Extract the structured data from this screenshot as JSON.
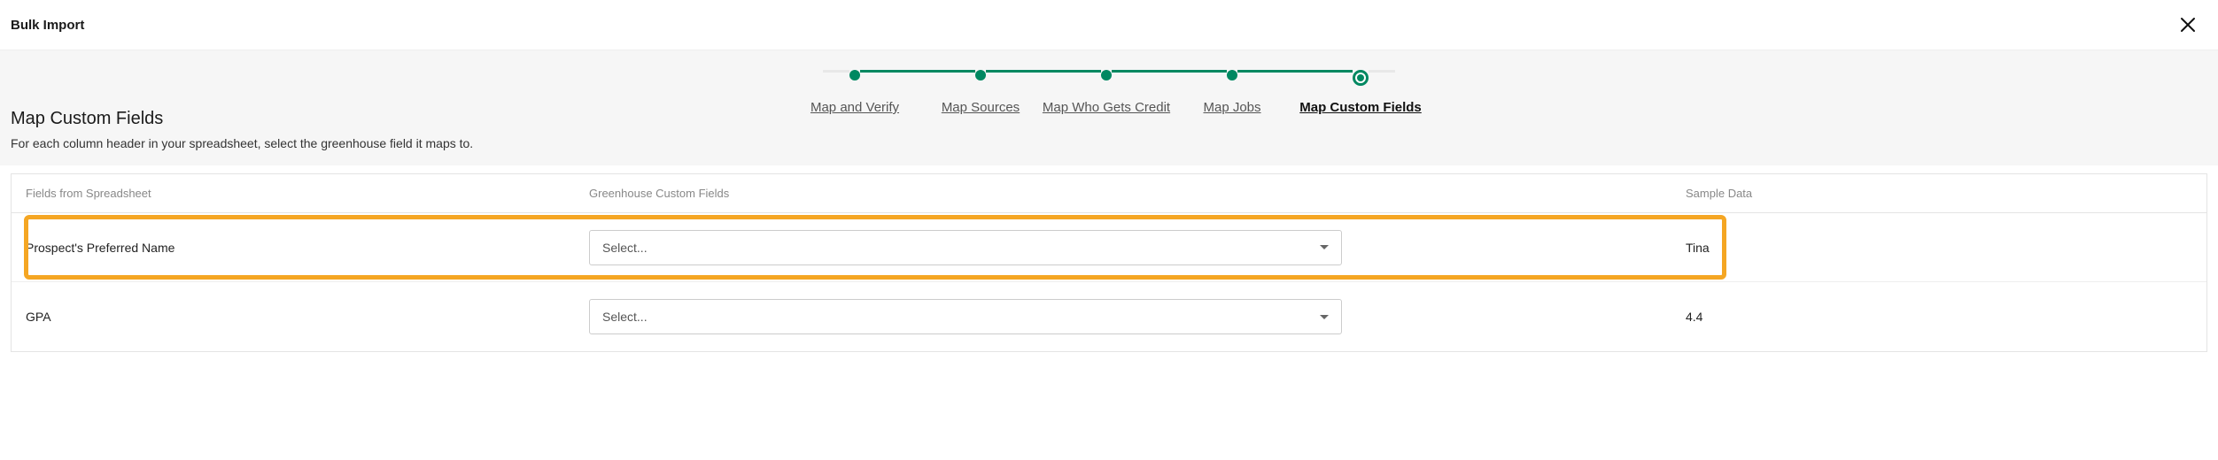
{
  "header": {
    "title": "Bulk Import"
  },
  "stepper": {
    "steps": [
      {
        "label": "Map and Verify",
        "state": "done"
      },
      {
        "label": "Map Sources",
        "state": "done"
      },
      {
        "label": "Map Who Gets Credit",
        "state": "done"
      },
      {
        "label": "Map Jobs",
        "state": "done"
      },
      {
        "label": "Map Custom Fields",
        "state": "current"
      }
    ]
  },
  "section": {
    "title": "Map Custom Fields",
    "description": "For each column header in your spreadsheet, select the greenhouse field it maps to."
  },
  "table": {
    "headers": {
      "field": "Fields from Spreadsheet",
      "custom": "Greenhouse Custom Fields",
      "sample": "Sample Data"
    },
    "rows": [
      {
        "field": "Prospect's Preferred Name",
        "select_placeholder": "Select...",
        "sample": "Tina",
        "highlight": true
      },
      {
        "field": "GPA",
        "select_placeholder": "Select...",
        "sample": "4.4",
        "highlight": false
      }
    ]
  }
}
